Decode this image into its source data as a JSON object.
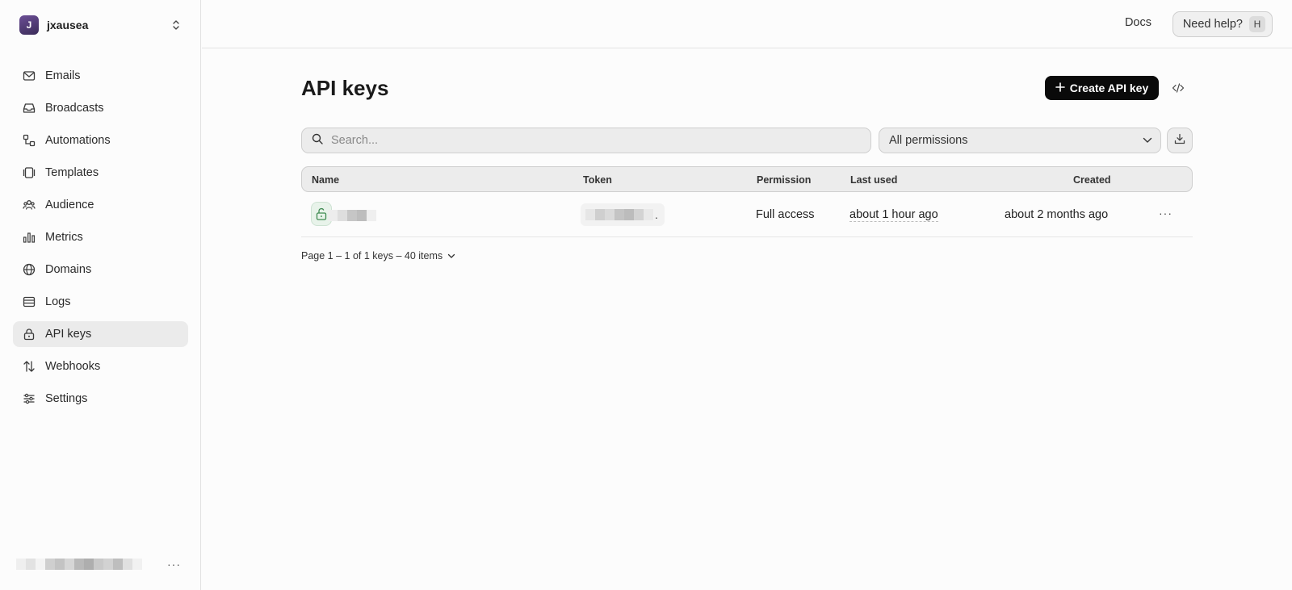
{
  "team": {
    "initial": "J",
    "name": "jxausea"
  },
  "sidebar": {
    "items": [
      {
        "label": "Emails"
      },
      {
        "label": "Broadcasts"
      },
      {
        "label": "Automations"
      },
      {
        "label": "Templates"
      },
      {
        "label": "Audience"
      },
      {
        "label": "Metrics"
      },
      {
        "label": "Domains"
      },
      {
        "label": "Logs"
      },
      {
        "label": "API keys"
      },
      {
        "label": "Webhooks"
      },
      {
        "label": "Settings"
      }
    ],
    "active": "API keys"
  },
  "topbar": {
    "docs": "Docs",
    "help": "Need help?",
    "help_key": "H"
  },
  "page": {
    "title": "API keys",
    "create_button": "Create API key"
  },
  "filters": {
    "search_placeholder": "Search...",
    "permission_select": "All permissions"
  },
  "table": {
    "headers": {
      "name": "Name",
      "token": "Token",
      "permission": "Permission",
      "last_used": "Last used",
      "created": "Created"
    },
    "rows": [
      {
        "permission": "Full access",
        "last_used": "about 1 hour ago",
        "created": "about 2 months ago",
        "token_suffix": "."
      }
    ]
  },
  "pagination": {
    "summary": "Page 1 – 1 of 1 keys – 40 items"
  },
  "colors": {
    "accent": "#0a0a0a",
    "active_nav": "#ebebeb",
    "key_icon": "#3f8a52"
  }
}
